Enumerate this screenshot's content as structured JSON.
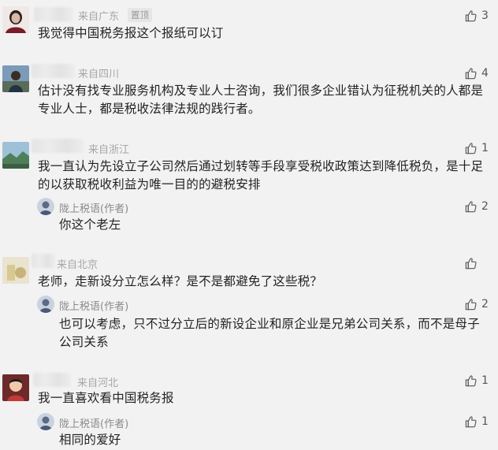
{
  "comments": [
    {
      "location": "来自广东",
      "badge": "置顶",
      "likes": "3",
      "text": "我觉得中国税务报这个报纸可以订"
    },
    {
      "location": "来自四川",
      "likes": "4",
      "text": "估计没有找专业服务机构及专业人士咨询，我们很多企业错认为征税机关的人都是专业人士，都是税收法律法规的践行者。"
    },
    {
      "location": "来自浙江",
      "likes": "1",
      "text": "我一直认为先设立子公司然后通过划转等手段享受税收政策达到降低税负，是十足的以获取税收利益为唯一目的的避税安排",
      "reply": {
        "author": "陇上税语(作者)",
        "likes": "2",
        "text": "你这个老左"
      }
    },
    {
      "location": "来自北京",
      "likes": "",
      "text": "老师，走新设分立怎么样？是不是都避免了这些税？",
      "reply": {
        "author": "陇上税语(作者)",
        "likes": "2",
        "text": "也可以考虑，只不过分立后的新设企业和原企业是兄弟公司关系，而不是母子公司关系"
      }
    },
    {
      "location": "来自河北",
      "likes": "1",
      "text": "我一直喜欢看中国税务报",
      "reply": {
        "author": "陇上税语(作者)",
        "likes": "1",
        "text": "相同的爱好"
      }
    }
  ],
  "colors": {
    "background": "#f2f2f2",
    "meta": "#a6a6a6",
    "text": "#222222",
    "thumb": "#555555"
  },
  "icons": {
    "like": "thumbs-up-icon"
  }
}
